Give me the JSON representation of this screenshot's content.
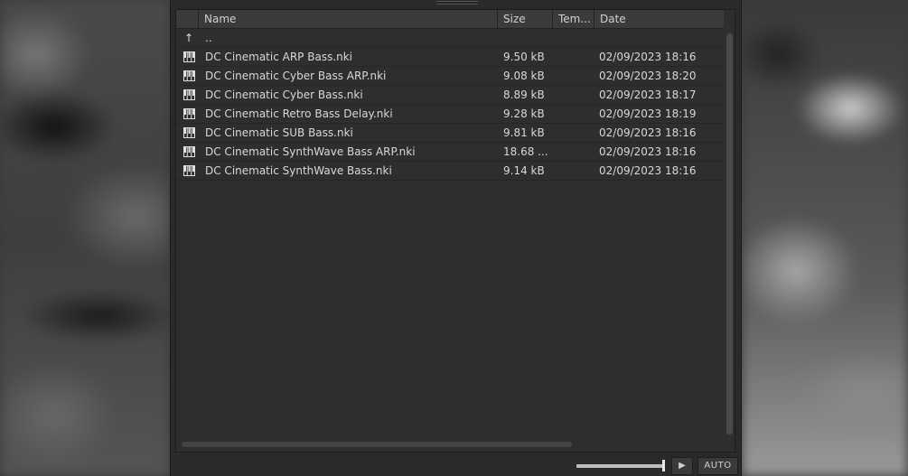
{
  "columns": {
    "name": "Name",
    "size": "Size",
    "tempo": "Tem...",
    "date": "Date"
  },
  "parent_row": {
    "icon": "up-arrow-icon",
    "glyph": "↑",
    "label": ".."
  },
  "files": [
    {
      "icon": "instrument-icon",
      "name": "DC Cinematic ARP Bass.nki",
      "size": "9.50 kB",
      "date": "02/09/2023 18:16"
    },
    {
      "icon": "instrument-icon",
      "name": "DC Cinematic Cyber Bass ARP.nki",
      "size": "9.08 kB",
      "date": "02/09/2023 18:20"
    },
    {
      "icon": "instrument-icon",
      "name": "DC Cinematic Cyber Bass.nki",
      "size": "8.89 kB",
      "date": "02/09/2023 18:17"
    },
    {
      "icon": "instrument-icon",
      "name": "DC Cinematic Retro Bass Delay.nki",
      "size": "9.28 kB",
      "date": "02/09/2023 18:19"
    },
    {
      "icon": "instrument-icon",
      "name": "DC Cinematic SUB Bass.nki",
      "size": "9.81 kB",
      "date": "02/09/2023 18:16"
    },
    {
      "icon": "instrument-icon",
      "name": "DC Cinematic SynthWave Bass ARP.nki",
      "size": "18.68 ...",
      "date": "02/09/2023 18:16"
    },
    {
      "icon": "instrument-icon",
      "name": "DC Cinematic SynthWave Bass.nki",
      "size": "9.14 kB",
      "date": "02/09/2023 18:16"
    }
  ],
  "footer": {
    "play_icon": "play-icon",
    "play_glyph": "▶",
    "auto_label": "AUTO",
    "volume_level": 1.0
  }
}
